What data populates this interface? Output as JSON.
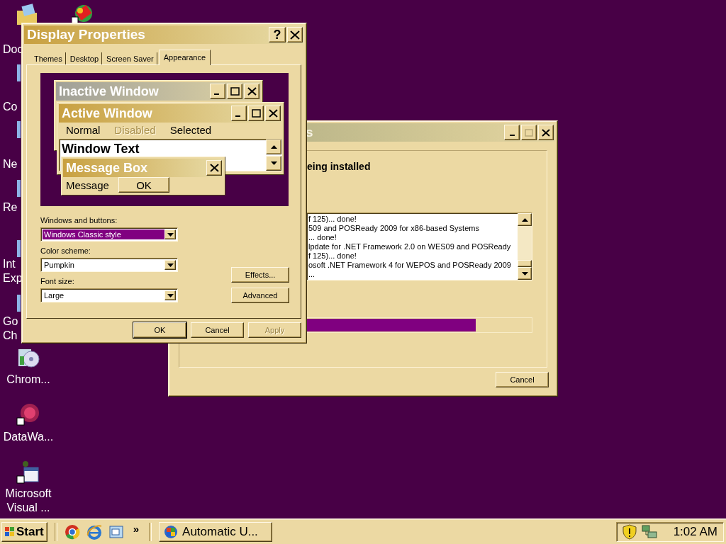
{
  "desktop_icons": [
    {
      "lines": [
        "Doc"
      ]
    },
    {
      "lines": [
        "Co"
      ]
    },
    {
      "lines": [
        "Ne"
      ]
    },
    {
      "lines": [
        "Re"
      ]
    },
    {
      "lines": [
        "Int",
        "Exp"
      ]
    },
    {
      "lines": [
        "Go",
        "Ch"
      ]
    },
    {
      "lines": [
        "Chrom..."
      ]
    },
    {
      "lines": [
        "DataWa..."
      ]
    },
    {
      "lines": [
        "Microsoft",
        "Visual ..."
      ]
    }
  ],
  "installer_window": {
    "title": "s",
    "heading": "eing installed",
    "log_lines": [
      "f 125)... done!",
      "509 and POSReady 2009 for x86-based Systems",
      "... done!",
      "lpdate for .NET Framework 2.0 on WES09 and POSReady",
      "f 125)... done!",
      "osoft .NET Framework 4 for WEPOS and POSReady 2009",
      "..."
    ],
    "progress": {
      "level": 0.75
    },
    "cancel_button": "Cancel"
  },
  "display_properties": {
    "title": "Display Properties",
    "help_button": "?",
    "tabs": [
      {
        "label": "Themes",
        "selected": false
      },
      {
        "label": "Desktop",
        "selected": false
      },
      {
        "label": "Screen Saver",
        "selected": false
      },
      {
        "label": "Appearance",
        "selected": true
      }
    ],
    "preview": {
      "inactive_window": {
        "title": "Inactive Window"
      },
      "active_window": {
        "title": "Active Window",
        "menu": [
          {
            "label": "Normal",
            "disabled": false
          },
          {
            "label": "Disabled",
            "disabled": true
          },
          {
            "label": "Selected",
            "disabled": false
          }
        ],
        "window_text": "Window Text"
      },
      "message_box": {
        "title": "Message Box",
        "text": "Message",
        "ok_button": "OK"
      }
    },
    "fields": [
      {
        "label": "Windows and buttons:",
        "value": "Windows Classic style",
        "selected": true
      },
      {
        "label": "Color scheme:",
        "value": "Pumpkin",
        "selected": false
      },
      {
        "label": "Font size:",
        "value": "Large",
        "selected": false
      }
    ],
    "side_buttons": [
      "Effects...",
      "Advanced"
    ],
    "buttons": [
      {
        "label": "OK",
        "default": true,
        "disabled": false
      },
      {
        "label": "Cancel",
        "default": false,
        "disabled": false
      },
      {
        "label": "Apply",
        "default": false,
        "disabled": true
      }
    ]
  },
  "taskbar": {
    "start": "Start",
    "more": "»",
    "tasks": [
      {
        "label": "Automatic U...",
        "selected": false
      }
    ],
    "clock": "1:02 AM"
  }
}
